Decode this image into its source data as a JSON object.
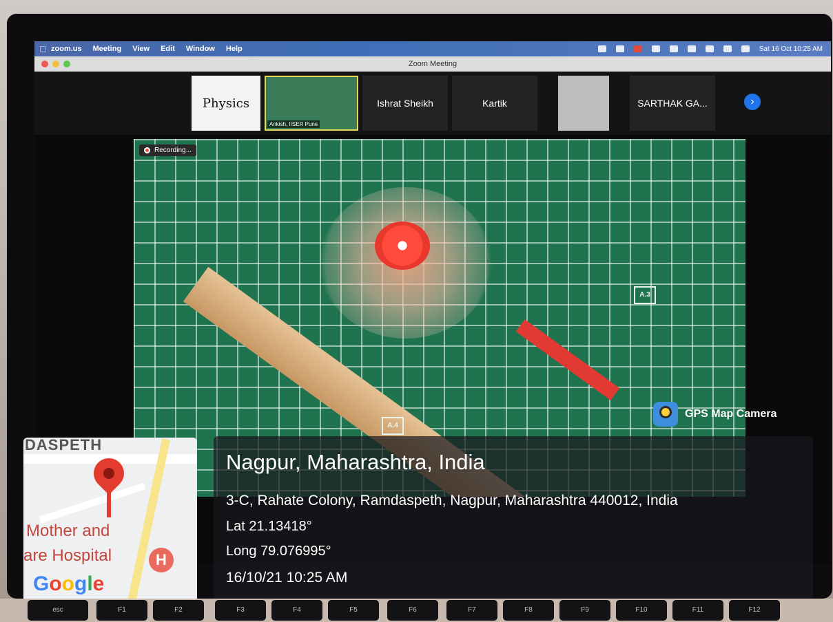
{
  "menubar": {
    "app": "zoom.us",
    "items": [
      "Meeting",
      "View",
      "Edit",
      "Window",
      "Help"
    ],
    "datetime": "Sat 16 Oct  10:25 AM"
  },
  "window": {
    "title": "Zoom Meeting"
  },
  "gallery": {
    "tiles": [
      {
        "label": "Physics"
      },
      {
        "label": "Ankish, IISER Pune"
      },
      {
        "label": "Ishrat Sheikh"
      },
      {
        "label": "Kartik"
      },
      {
        "label": ""
      },
      {
        "label": "SARTHAK GA..."
      }
    ]
  },
  "video": {
    "recording_label": "Recording...",
    "marks": [
      "A.3",
      "A.4"
    ]
  },
  "gps": {
    "brand": "GPS Map Camera",
    "city": "Nagpur, Maharashtra, India",
    "address": "3-C, Rahate Colony, Ramdaspeth, Nagpur, Maharashtra 440012, India",
    "lat": "Lat 21.13418°",
    "long": "Long 79.076995°",
    "datetime": "16/10/21 10:25 AM"
  },
  "map": {
    "top_label": "DASPETH",
    "label1": "Mother and",
    "label2": "are Hospital",
    "hospital_icon": "H",
    "google_letters": [
      "G",
      "o",
      "o",
      "g",
      "l",
      "e"
    ]
  },
  "keyboard": {
    "keys": [
      "esc",
      "F1",
      "F2",
      "F3",
      "F4",
      "F5",
      "F6",
      "F7",
      "F8",
      "F9",
      "F10",
      "F11",
      "F12"
    ]
  },
  "colors": {
    "accent": "#1e74e8",
    "recording": "#f04b3e",
    "mat": "#20734f"
  }
}
